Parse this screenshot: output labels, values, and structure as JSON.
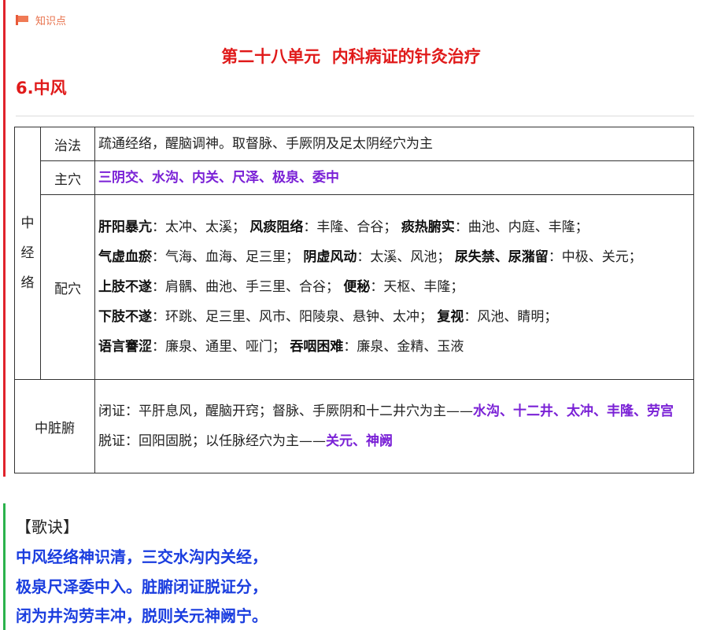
{
  "header": {
    "tag": "知识点",
    "unit_title": "第二十八单元  内科病证的针灸治疗",
    "sub_title": "6.中风"
  },
  "table": {
    "group_label": [
      "中",
      "经",
      "络"
    ],
    "zhifa": {
      "label": "治法",
      "text": "疏通经络，醒脑调神。取督脉、手厥阴及足太阴经穴为主"
    },
    "zhuxue": {
      "label": "主穴",
      "text": "三阴交、水沟、内关、尺泽、极泉、委中"
    },
    "peixue": {
      "label": "配穴",
      "items": [
        {
          "name": "肝阳暴亢",
          "points": "：太冲、太溪；"
        },
        {
          "name": "风痰阻络",
          "points": "：丰隆、合谷；"
        },
        {
          "name": "痰热腑实",
          "points": "：曲池、内庭、丰隆；"
        },
        {
          "name": "气虚血瘀",
          "points": "：气海、血海、足三里；"
        },
        {
          "name": "阴虚风动",
          "points": "：太溪、风池；"
        },
        {
          "name": "尿失禁、尿潴留",
          "points": "：中极、关元；"
        },
        {
          "name": "上肢不遂",
          "points": "：肩髃、曲池、手三里、合谷；"
        },
        {
          "name": "便秘",
          "points": "：天枢、丰隆；"
        },
        {
          "name": "下肢不遂",
          "points": "：环跳、足三里、风市、阳陵泉、悬钟、太冲；"
        },
        {
          "name": "复视",
          "points": "：风池、睛明；"
        },
        {
          "name": "语言謇涩",
          "points": "：廉泉、通里、哑门；"
        },
        {
          "name": "吞咽困难",
          "points": "：廉泉、金精、玉液"
        }
      ]
    },
    "zangfu": {
      "label": "中脏腑",
      "bizheng": {
        "text": "闭证：平肝息风，醒脑开窍；督脉、手厥阴和十二井穴为主——",
        "points": "水沟、十二井、太冲、丰隆、劳宫"
      },
      "tuozheng": {
        "text": "脱证：回阳固脱；以任脉经穴为主——",
        "points": "关元、神阙"
      }
    }
  },
  "gejue": {
    "title": "【歌诀】",
    "lines": [
      "中风经络神识清，三交水沟内关经，",
      "极泉尺泽委中入。脏腑闭证脱证分，",
      "闭为井沟劳丰冲，脱则关元神阙宁。"
    ]
  },
  "colors": {
    "title_red": "#e01a1a",
    "acupoint_purple": "#7a21d6",
    "verse_blue": "#1a3ddf",
    "section_bar_red": "#e0232b",
    "section_bar_green": "#2bb24c"
  }
}
